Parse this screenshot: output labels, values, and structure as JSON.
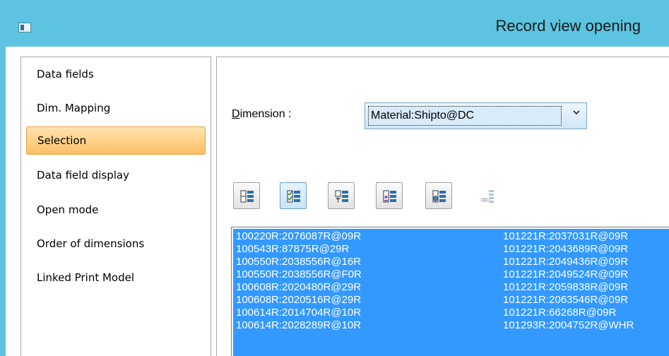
{
  "window": {
    "title": "Record view opening"
  },
  "nav": {
    "items": [
      {
        "label": "Data fields",
        "selected": false
      },
      {
        "label": "Dim. Mapping",
        "selected": false
      },
      {
        "label": "Selection",
        "selected": true
      },
      {
        "label": "Data field display",
        "selected": false
      },
      {
        "label": "Open mode",
        "selected": false
      },
      {
        "label": "Order of dimensions",
        "selected": false
      },
      {
        "label": "Linked Print Model",
        "selected": false
      }
    ]
  },
  "dimension": {
    "label": "Dimension :",
    "value": "Material:Shipto@DC"
  },
  "toolbar": {
    "buttons": [
      {
        "icon": "list-view-icon",
        "state": "normal"
      },
      {
        "icon": "checked-list-icon",
        "state": "active"
      },
      {
        "icon": "filter-list-icon",
        "state": "normal"
      },
      {
        "icon": "user-list-icon",
        "state": "normal"
      },
      {
        "icon": "cube-list-icon",
        "state": "normal"
      },
      {
        "icon": "link-list-icon",
        "state": "disabled"
      }
    ]
  },
  "list": {
    "left_column": [
      "100220R:2076087R@09R",
      "100543R:87875R@29R",
      "100550R:2038556R@16R",
      "100550R:2038556R@F0R",
      "100608R:2020480R@29R",
      "100608R:2020516R@29R",
      "100614R:2014704R@10R",
      "100614R:2028289R@10R"
    ],
    "right_column": [
      "101221R:2037031R@09R",
      "101221R:2043689R@09R",
      "101221R:2049436R@09R",
      "101221R:2049524R@09R",
      "101221R:2059838R@09R",
      "101221R:2063546R@09R",
      "101221R:66268R@09R",
      "101293R:2004752R@WHR"
    ]
  },
  "colors": {
    "titlebar": "#5cc3e0",
    "selection_highlight": "#3399ff",
    "nav_selected": "#fbc066"
  }
}
